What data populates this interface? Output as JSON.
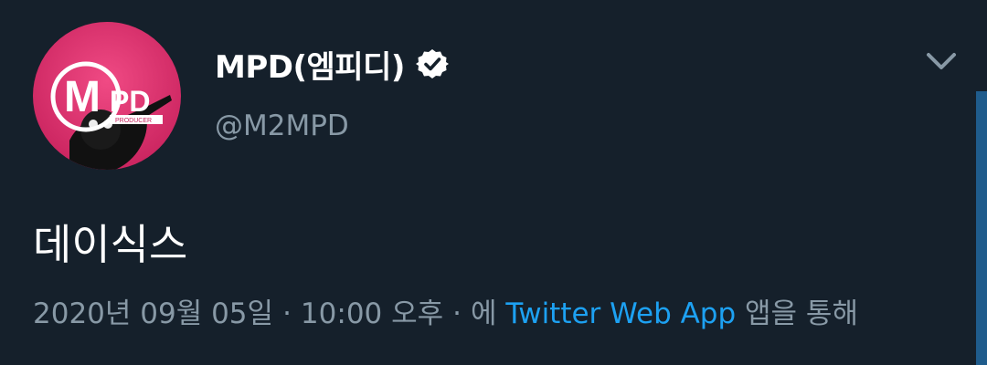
{
  "colors": {
    "background": "#15202b",
    "primary_text": "#ffffff",
    "secondary_text": "#8899a6",
    "link": "#1da1f2",
    "avatar_bg": "#e0336d"
  },
  "user": {
    "display_name": "MPD(엠피디)",
    "handle": "@M2MPD",
    "avatar_logo_text": "MPD",
    "avatar_logo_subtext": "PRODUCER",
    "verified_icon": "verified-badge-icon"
  },
  "tweet": {
    "text": "데이식스"
  },
  "meta": {
    "date": "2020년 09월 05일",
    "separator": "·",
    "time": "10:00 오후",
    "via_prefix": "에",
    "source": "Twitter Web App",
    "via_suffix": "앱을 통해"
  },
  "menu": {
    "icon": "chevron-down-icon"
  }
}
